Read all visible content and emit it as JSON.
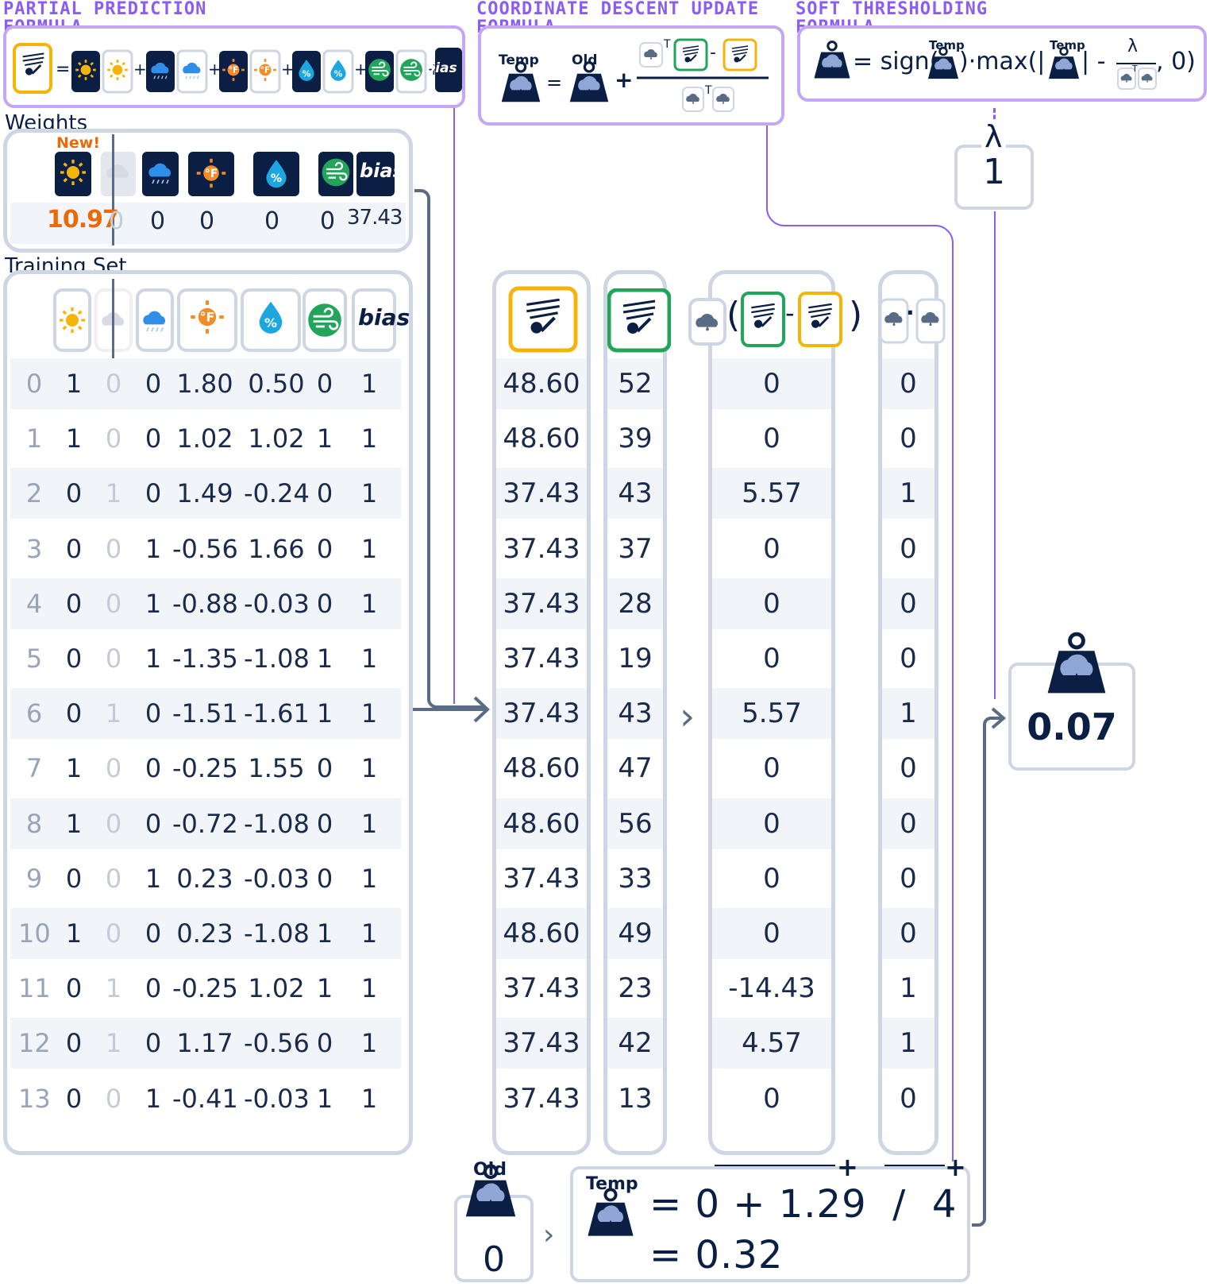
{
  "formulas": {
    "partial": {
      "title": "PARTIAL PREDICTION\nFORMULA",
      "bias": "bias"
    },
    "coordinate": {
      "title": "COORDINATE DESCENT UPDATE\nFORMULA",
      "temp": "Temp",
      "old": "Old",
      "eq": "=",
      "plus": "+",
      "minus": "-",
      "t1": "T",
      "t2": "T"
    },
    "soft": {
      "title": "SOFT THRESHOLDING\nFORMULA",
      "temp1": "Temp",
      "temp2": "Temp",
      "eq_sign": "= sign(",
      "mid": ")·max(|",
      "bar": "| -",
      "lambda": "λ",
      "tail": ", 0)",
      "t": "T"
    }
  },
  "lambda_box": {
    "symbol": "λ",
    "value": "1"
  },
  "weights": {
    "label": "Weights",
    "new_badge": "New!",
    "bias_label": "bias",
    "values": [
      "10.97",
      "0",
      "0",
      "0",
      "0",
      "0",
      "37.43"
    ]
  },
  "training_set": {
    "label": "Training Set",
    "bias_label": "bias",
    "rows": [
      [
        "0",
        "1",
        "0",
        "0",
        "1.80",
        "0.50",
        "0",
        "1"
      ],
      [
        "1",
        "1",
        "0",
        "0",
        "1.02",
        "1.02",
        "1",
        "1"
      ],
      [
        "2",
        "0",
        "1",
        "0",
        "1.49",
        "-0.24",
        "0",
        "1"
      ],
      [
        "3",
        "0",
        "0",
        "1",
        "-0.56",
        "1.66",
        "0",
        "1"
      ],
      [
        "4",
        "0",
        "0",
        "1",
        "-0.88",
        "-0.03",
        "0",
        "1"
      ],
      [
        "5",
        "0",
        "0",
        "1",
        "-1.35",
        "-1.08",
        "1",
        "1"
      ],
      [
        "6",
        "0",
        "1",
        "0",
        "-1.51",
        "-1.61",
        "1",
        "1"
      ],
      [
        "7",
        "1",
        "0",
        "0",
        "-0.25",
        "1.55",
        "0",
        "1"
      ],
      [
        "8",
        "1",
        "0",
        "0",
        "-0.72",
        "-1.08",
        "0",
        "1"
      ],
      [
        "9",
        "0",
        "0",
        "1",
        "0.23",
        "-0.03",
        "0",
        "1"
      ],
      [
        "10",
        "1",
        "0",
        "0",
        "0.23",
        "-1.08",
        "1",
        "1"
      ],
      [
        "11",
        "0",
        "1",
        "0",
        "-0.25",
        "1.02",
        "1",
        "1"
      ],
      [
        "12",
        "0",
        "1",
        "0",
        "1.17",
        "-0.56",
        "0",
        "1"
      ],
      [
        "13",
        "0",
        "0",
        "1",
        "-0.41",
        "-0.03",
        "1",
        "1"
      ]
    ]
  },
  "columns": {
    "partial_pred": [
      "48.60",
      "48.60",
      "37.43",
      "37.43",
      "37.43",
      "37.43",
      "37.43",
      "48.60",
      "48.60",
      "37.43",
      "48.60",
      "37.43",
      "37.43",
      "37.43"
    ],
    "actual": [
      "52",
      "39",
      "43",
      "37",
      "28",
      "19",
      "43",
      "47",
      "56",
      "33",
      "49",
      "23",
      "42",
      "13"
    ],
    "residual_product": [
      "0",
      "0",
      "5.57",
      "0",
      "0",
      "0",
      "5.57",
      "0",
      "0",
      "0",
      "0",
      "-14.43",
      "4.57",
      "0"
    ],
    "feature_sq": [
      "0",
      "0",
      "1",
      "0",
      "0",
      "0",
      "1",
      "0",
      "0",
      "0",
      "0",
      "1",
      "1",
      "0"
    ],
    "residual_header": {
      "open": "(",
      "minus": "-",
      "close": ")"
    },
    "sq_header": {
      "dot": "·"
    },
    "chevron": "›"
  },
  "result": {
    "value": "0.07"
  },
  "old_box": {
    "label": "Old",
    "value": "0",
    "chevron": "›"
  },
  "temp_box": {
    "label": "Temp",
    "line1": "= 0 + 1.29  /  4",
    "line2": "= 0.32",
    "plus1": "+",
    "plus2": "+"
  },
  "colors": {
    "purple": "#8b5cf6",
    "purple_light": "#c4a6f5",
    "orange": "#ea6a0a",
    "yellow": "#f5b40a",
    "green": "#22a45a",
    "border": "#cfd6e3",
    "navy": "#0b1f44"
  }
}
